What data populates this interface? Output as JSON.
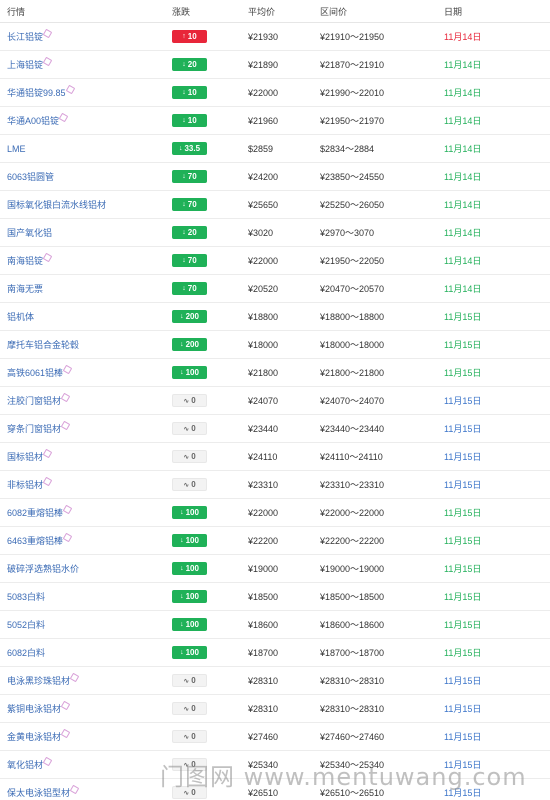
{
  "header": {
    "name": "行情",
    "change": "涨跌",
    "avg": "平均价",
    "range": "区间价",
    "date": "日期"
  },
  "rows": [
    {
      "name": "长江铝锭",
      "edit": true,
      "change": "10",
      "dir": "up",
      "avg": "¥21930",
      "range": "¥21910～21950",
      "date": "11月14日",
      "date_color": "red"
    },
    {
      "name": "上海铝锭",
      "edit": true,
      "change": "20",
      "dir": "down",
      "avg": "¥21890",
      "range": "¥21870～21910",
      "date": "11月14日",
      "date_color": "green"
    },
    {
      "name": "华通铝锭99.85",
      "edit": true,
      "change": "10",
      "dir": "down",
      "avg": "¥22000",
      "range": "¥21990～22010",
      "date": "11月14日",
      "date_color": "green"
    },
    {
      "name": "华通A00铝锭",
      "edit": true,
      "change": "10",
      "dir": "down",
      "avg": "¥21960",
      "range": "¥21950～21970",
      "date": "11月14日",
      "date_color": "green"
    },
    {
      "name": "LME",
      "edit": false,
      "change": "33.5",
      "dir": "down",
      "avg": "$2859",
      "range": "$2834～2884",
      "date": "11月14日",
      "date_color": "green"
    },
    {
      "name": "6063铝圆管",
      "edit": false,
      "change": "70",
      "dir": "down",
      "avg": "¥24200",
      "range": "¥23850～24550",
      "date": "11月14日",
      "date_color": "green"
    },
    {
      "name": "国标氧化银白流水线铝材",
      "edit": false,
      "change": "70",
      "dir": "down",
      "avg": "¥25650",
      "range": "¥25250～26050",
      "date": "11月14日",
      "date_color": "green"
    },
    {
      "name": "国产氧化铝",
      "edit": false,
      "change": "20",
      "dir": "down",
      "avg": "¥3020",
      "range": "¥2970～3070",
      "date": "11月14日",
      "date_color": "green"
    },
    {
      "name": "南海铝锭",
      "edit": true,
      "change": "70",
      "dir": "down",
      "avg": "¥22000",
      "range": "¥21950～22050",
      "date": "11月14日",
      "date_color": "green"
    },
    {
      "name": "南海无票",
      "edit": false,
      "change": "70",
      "dir": "down",
      "avg": "¥20520",
      "range": "¥20470～20570",
      "date": "11月14日",
      "date_color": "green"
    },
    {
      "name": "铝机体",
      "edit": false,
      "change": "200",
      "dir": "down",
      "avg": "¥18800",
      "range": "¥18800～18800",
      "date": "11月15日",
      "date_color": "green"
    },
    {
      "name": "摩托车铝合金轮毂",
      "edit": false,
      "change": "200",
      "dir": "down",
      "avg": "¥18000",
      "range": "¥18000～18000",
      "date": "11月15日",
      "date_color": "green"
    },
    {
      "name": "高铁6061铝棒",
      "edit": true,
      "change": "100",
      "dir": "down",
      "avg": "¥21800",
      "range": "¥21800～21800",
      "date": "11月15日",
      "date_color": "green"
    },
    {
      "name": "注胶门窗铝材",
      "edit": true,
      "change": "0",
      "dir": "flat",
      "avg": "¥24070",
      "range": "¥24070～24070",
      "date": "11月15日",
      "date_color": "blue"
    },
    {
      "name": "穿条门窗铝材",
      "edit": true,
      "change": "0",
      "dir": "flat",
      "avg": "¥23440",
      "range": "¥23440～23440",
      "date": "11月15日",
      "date_color": "blue"
    },
    {
      "name": "国标铝材",
      "edit": true,
      "change": "0",
      "dir": "flat",
      "avg": "¥24110",
      "range": "¥24110～24110",
      "date": "11月15日",
      "date_color": "blue"
    },
    {
      "name": "非标铝材",
      "edit": true,
      "change": "0",
      "dir": "flat",
      "avg": "¥23310",
      "range": "¥23310～23310",
      "date": "11月15日",
      "date_color": "blue"
    },
    {
      "name": "6082重熔铝棒",
      "edit": true,
      "change": "100",
      "dir": "down",
      "avg": "¥22000",
      "range": "¥22000～22000",
      "date": "11月15日",
      "date_color": "green"
    },
    {
      "name": "6463重熔铝棒",
      "edit": true,
      "change": "100",
      "dir": "down",
      "avg": "¥22200",
      "range": "¥22200～22200",
      "date": "11月15日",
      "date_color": "green"
    },
    {
      "name": "破碎浮选熟铝水价",
      "edit": false,
      "change": "100",
      "dir": "down",
      "avg": "¥19000",
      "range": "¥19000～19000",
      "date": "11月15日",
      "date_color": "green"
    },
    {
      "name": "5083白料",
      "edit": false,
      "change": "100",
      "dir": "down",
      "avg": "¥18500",
      "range": "¥18500～18500",
      "date": "11月15日",
      "date_color": "green"
    },
    {
      "name": "5052白料",
      "edit": false,
      "change": "100",
      "dir": "down",
      "avg": "¥18600",
      "range": "¥18600～18600",
      "date": "11月15日",
      "date_color": "green"
    },
    {
      "name": "6082白料",
      "edit": false,
      "change": "100",
      "dir": "down",
      "avg": "¥18700",
      "range": "¥18700～18700",
      "date": "11月15日",
      "date_color": "green"
    },
    {
      "name": "电泳黑珍珠铝材",
      "edit": true,
      "change": "0",
      "dir": "flat",
      "avg": "¥28310",
      "range": "¥28310～28310",
      "date": "11月15日",
      "date_color": "blue"
    },
    {
      "name": "紫铜电泳铝材",
      "edit": true,
      "change": "0",
      "dir": "flat",
      "avg": "¥28310",
      "range": "¥28310～28310",
      "date": "11月15日",
      "date_color": "blue"
    },
    {
      "name": "金黄电泳铝材",
      "edit": true,
      "change": "0",
      "dir": "flat",
      "avg": "¥27460",
      "range": "¥27460～27460",
      "date": "11月15日",
      "date_color": "blue"
    },
    {
      "name": "氧化铝材",
      "edit": true,
      "change": "0",
      "dir": "flat",
      "avg": "¥25340",
      "range": "¥25340～25340",
      "date": "11月15日",
      "date_color": "blue"
    },
    {
      "name": "保太电泳铝型材",
      "edit": true,
      "change": "0",
      "dir": "flat",
      "avg": "¥26510",
      "range": "¥26510～26510",
      "date": "11月15日",
      "date_color": "blue"
    }
  ],
  "watermark": "门图网 www.mentuwang.com",
  "colors": {
    "up": "#e8263a",
    "down": "#1fb158",
    "link": "#3b6bb5"
  }
}
